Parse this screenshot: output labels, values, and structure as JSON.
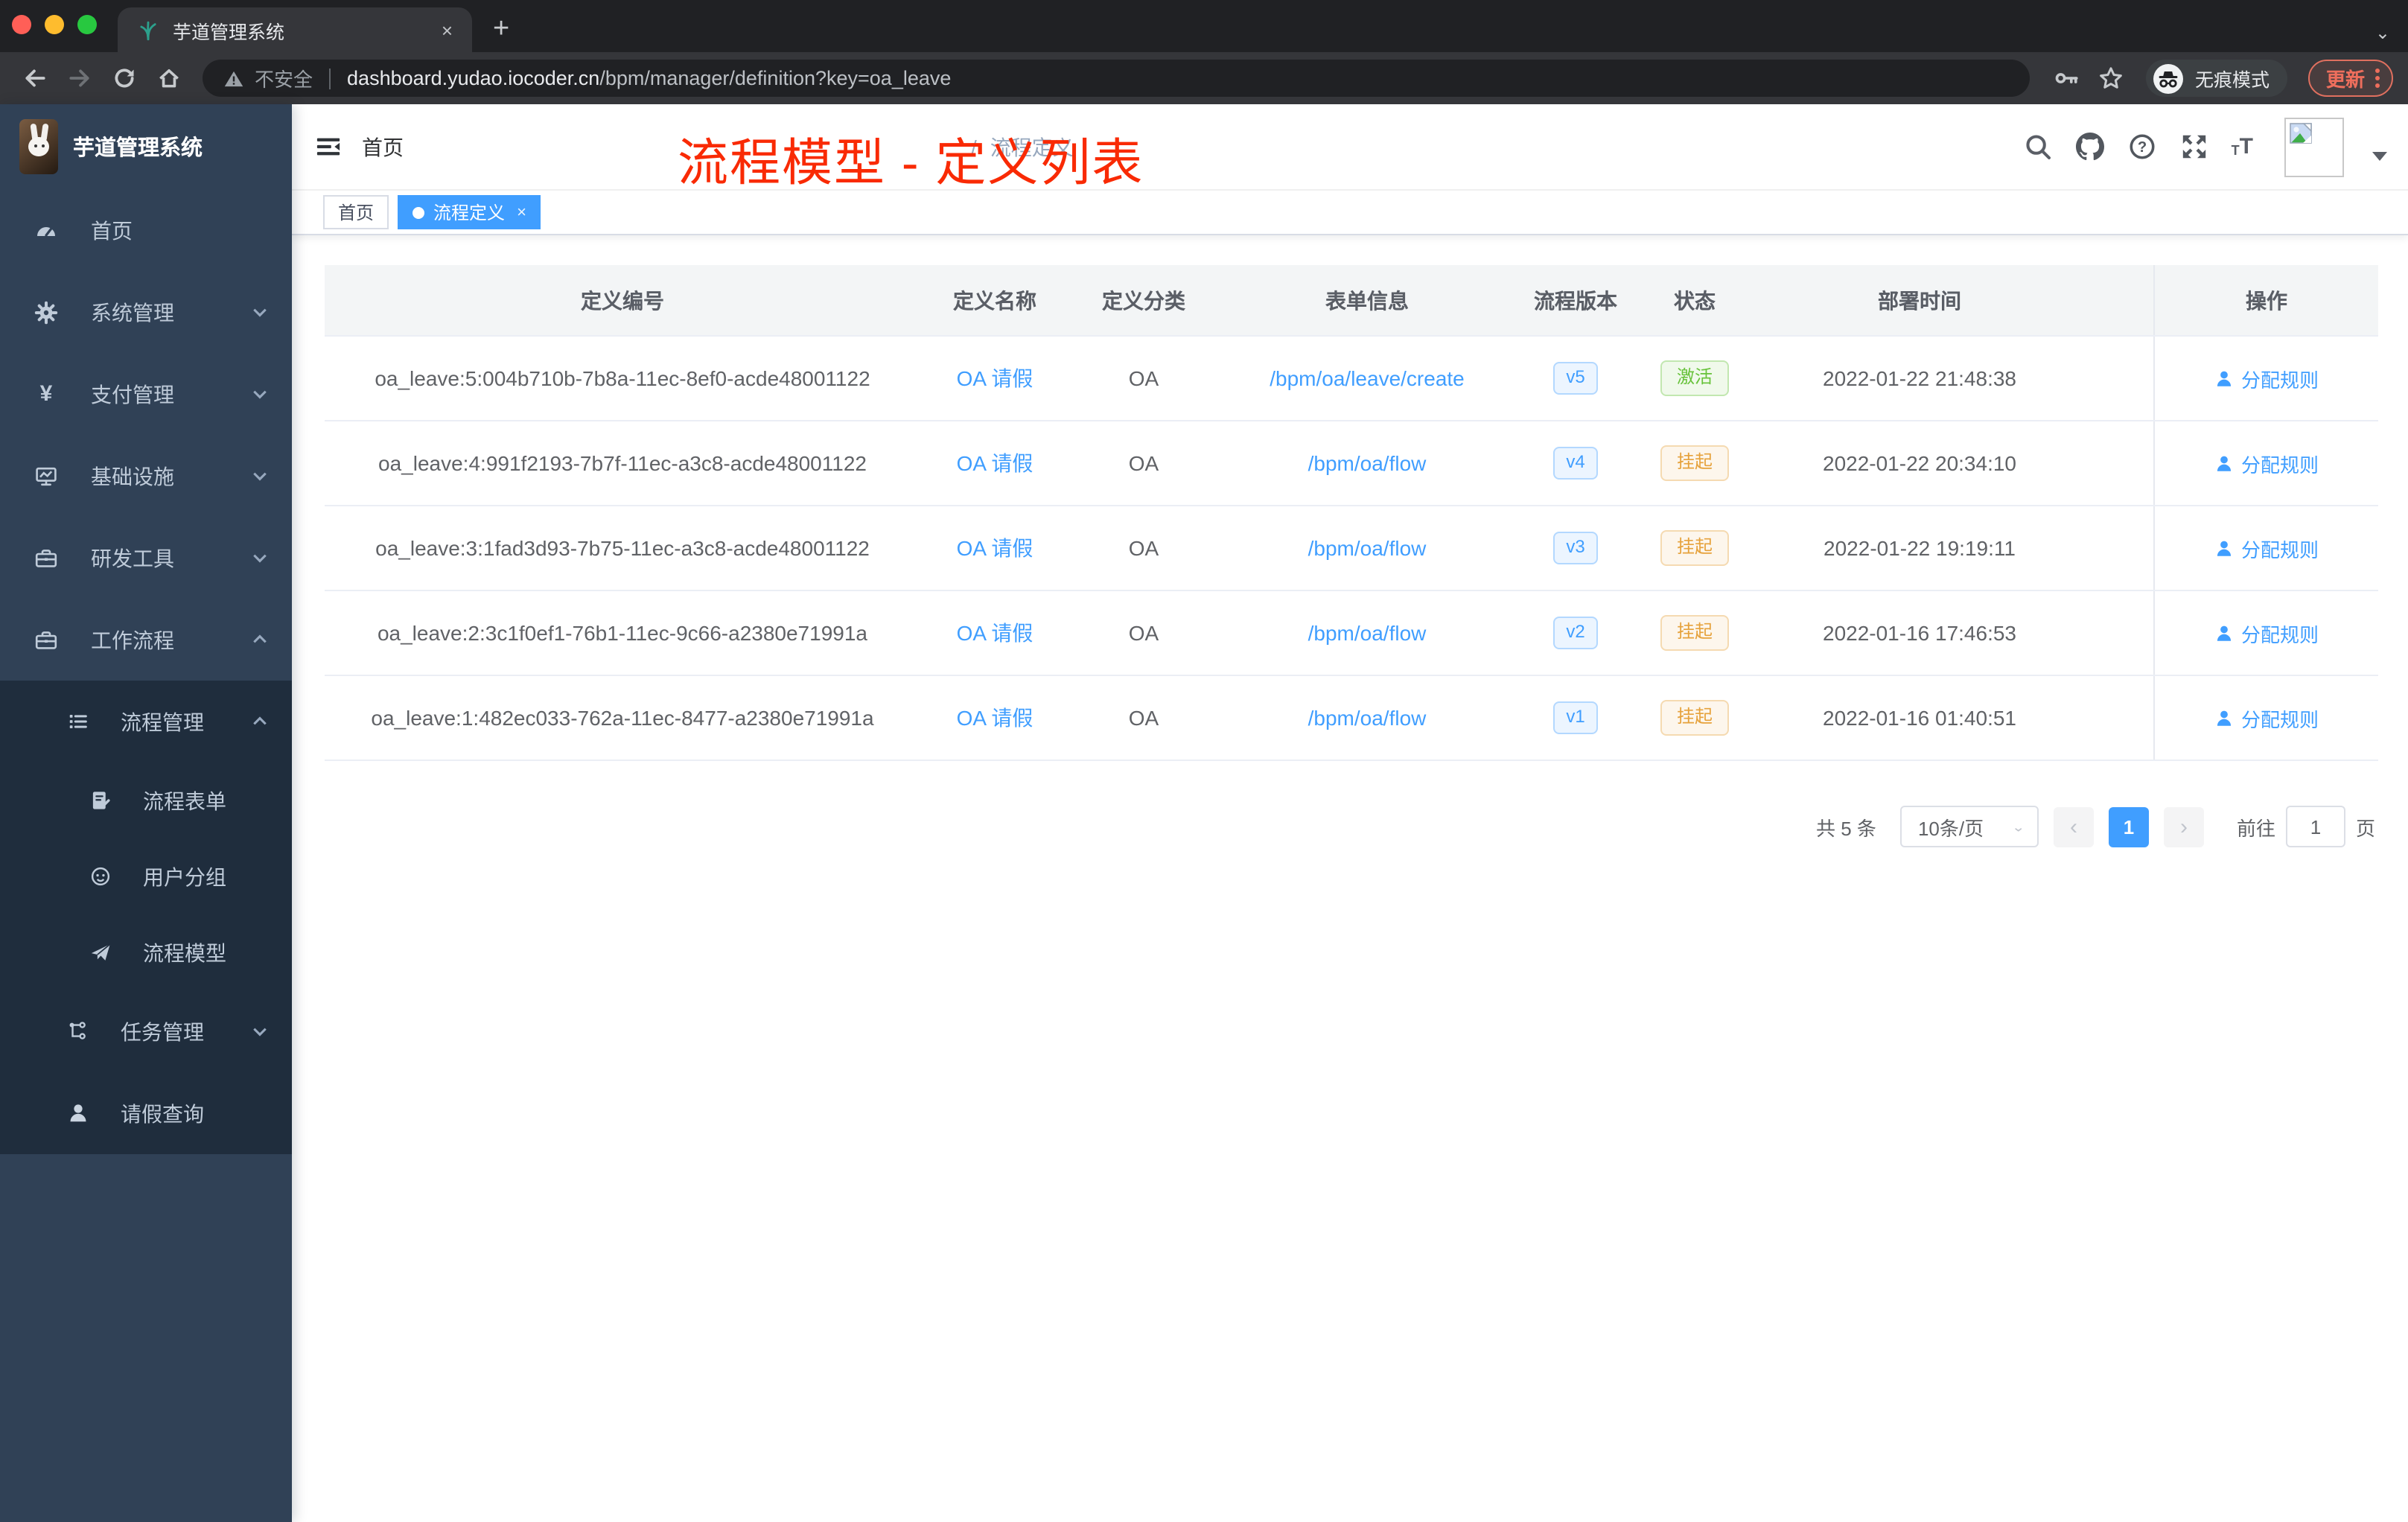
{
  "browser": {
    "tab_title": "芋道管理系统",
    "close_tab": "×",
    "new_tab": "+",
    "security_label": "不安全",
    "url_domain": "dashboard.yudao.iocoder.cn",
    "url_path": "/bpm/manager/definition?key=oa_leave",
    "incognito_label": "无痕模式",
    "update_label": "更新"
  },
  "sidebar": {
    "logo_title": "芋道管理系统",
    "items": [
      {
        "label": "首页"
      },
      {
        "label": "系统管理"
      },
      {
        "label": "支付管理"
      },
      {
        "label": "基础设施"
      },
      {
        "label": "研发工具"
      },
      {
        "label": "工作流程"
      },
      {
        "label": "流程管理"
      },
      {
        "label": "流程表单"
      },
      {
        "label": "用户分组"
      },
      {
        "label": "流程模型"
      },
      {
        "label": "任务管理"
      },
      {
        "label": "请假查询"
      }
    ]
  },
  "navbar": {
    "breadcrumb_home": "首页",
    "breadcrumb_sep": "/",
    "breadcrumb_current": "流程定义"
  },
  "tags": {
    "home": "首页",
    "active": "流程定义",
    "close": "×"
  },
  "annotation": "流程模型 - 定义列表",
  "table": {
    "headers": [
      "定义编号",
      "定义名称",
      "定义分类",
      "表单信息",
      "流程版本",
      "状态",
      "部署时间",
      "操作"
    ],
    "rows": [
      {
        "id": "oa_leave:5:004b710b-7b8a-11ec-8ef0-acde48001122",
        "name": "OA 请假",
        "category": "OA",
        "form": "/bpm/oa/leave/create",
        "version": "v5",
        "status": "激活",
        "status_type": "active",
        "time": "2022-01-22 21:48:38",
        "action": "分配规则"
      },
      {
        "id": "oa_leave:4:991f2193-7b7f-11ec-a3c8-acde48001122",
        "name": "OA 请假",
        "category": "OA",
        "form": "/bpm/oa/flow",
        "version": "v4",
        "status": "挂起",
        "status_type": "suspended",
        "time": "2022-01-22 20:34:10",
        "action": "分配规则"
      },
      {
        "id": "oa_leave:3:1fad3d93-7b75-11ec-a3c8-acde48001122",
        "name": "OA 请假",
        "category": "OA",
        "form": "/bpm/oa/flow",
        "version": "v3",
        "status": "挂起",
        "status_type": "suspended",
        "time": "2022-01-22 19:19:11",
        "action": "分配规则"
      },
      {
        "id": "oa_leave:2:3c1f0ef1-76b1-11ec-9c66-a2380e71991a",
        "name": "OA 请假",
        "category": "OA",
        "form": "/bpm/oa/flow",
        "version": "v2",
        "status": "挂起",
        "status_type": "suspended",
        "time": "2022-01-16 17:46:53",
        "action": "分配规则"
      },
      {
        "id": "oa_leave:1:482ec033-762a-11ec-8477-a2380e71991a",
        "name": "OA 请假",
        "category": "OA",
        "form": "/bpm/oa/flow",
        "version": "v1",
        "status": "挂起",
        "status_type": "suspended",
        "time": "2022-01-16 01:40:51",
        "action": "分配规则"
      }
    ]
  },
  "pagination": {
    "total": "共 5 条",
    "page_size": "10条/页",
    "prev": "‹",
    "page": "1",
    "next": "›",
    "goto_label": "前往",
    "goto_value": "1",
    "unit": "页"
  },
  "colors": {
    "accent": "#409eff",
    "sidebar_bg": "#304156",
    "submenu_bg": "#1f2d3d",
    "annotation_red": "#f92a04",
    "status_active": "#67c23a",
    "status_suspended": "#e6a23c"
  }
}
